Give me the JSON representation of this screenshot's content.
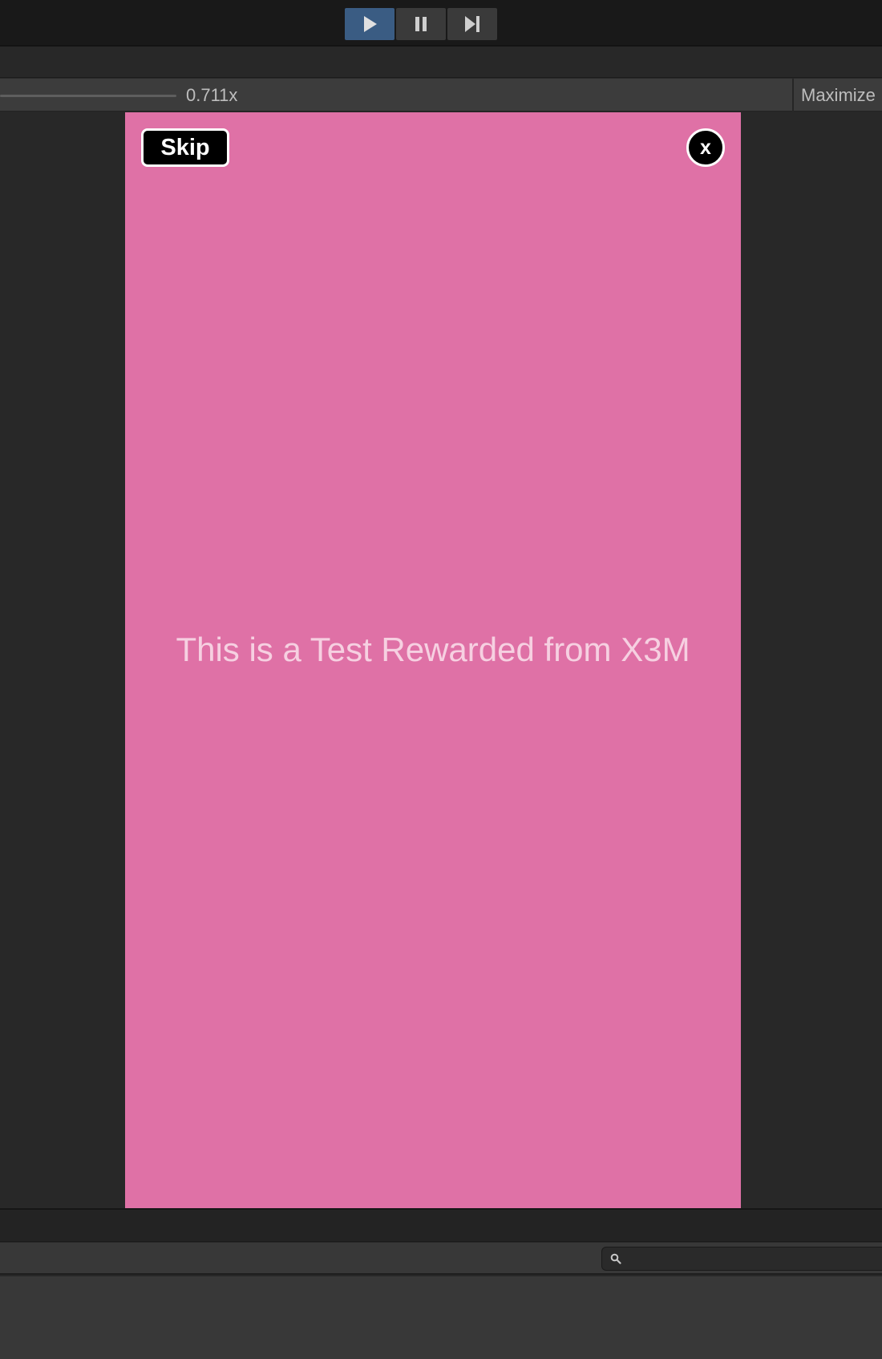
{
  "toolbar": {
    "play_icon": "play-icon",
    "pause_icon": "pause-icon",
    "step_icon": "step-forward-icon",
    "active_color": "#3a5c83"
  },
  "game_view": {
    "scale_value": "0.711x",
    "maximize_label": "Maximize"
  },
  "ad": {
    "background_color": "#df71a6",
    "skip_label": "Skip",
    "close_label": "x",
    "message": "This is a Test Rewarded from X3M"
  },
  "console": {
    "search_icon": "search-icon",
    "search_value": ""
  }
}
